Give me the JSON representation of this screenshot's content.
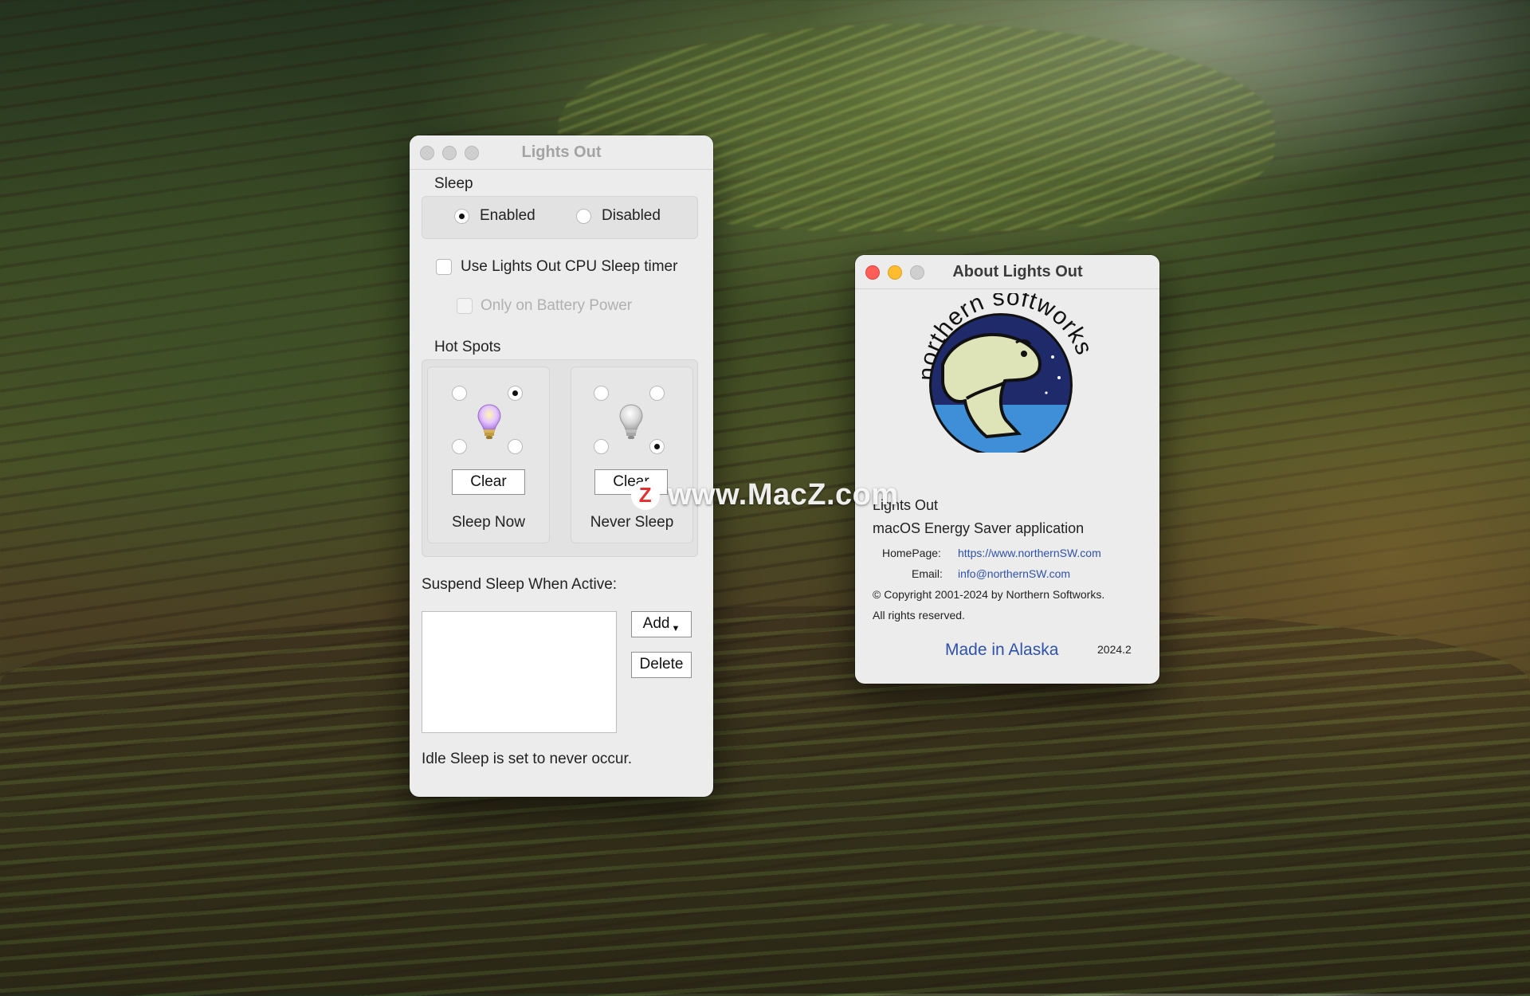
{
  "desktop": {
    "background": "forest-vineyard-wallpaper"
  },
  "main_window": {
    "title": "Lights Out",
    "sleep": {
      "section_label": "Sleep",
      "options": [
        {
          "label": "Enabled",
          "selected": true
        },
        {
          "label": "Disabled",
          "selected": false
        }
      ]
    },
    "cpu_timer": {
      "label": "Use Lights Out CPU Sleep timer",
      "checked": false
    },
    "battery_only": {
      "label": "Only on Battery Power",
      "checked": false,
      "enabled": false
    },
    "hot_spots": {
      "section_label": "Hot Spots",
      "panels": [
        {
          "clear_label": "Clear",
          "caption": "Sleep Now",
          "selected_corner": "top-right",
          "bulb": "lit-bulb-icon"
        },
        {
          "clear_label": "Clear",
          "caption": "Never Sleep",
          "selected_corner": "bottom-right",
          "bulb": "unlit-bulb-icon"
        }
      ]
    },
    "suspend": {
      "label": "Suspend Sleep When Active:",
      "add_label": "Add",
      "delete_label": "Delete",
      "items": []
    },
    "status": "Idle Sleep is set to never occur."
  },
  "about_window": {
    "title": "About Lights Out",
    "logo_text": "northern softworks",
    "app_name": "Lights Out",
    "description": "macOS Energy Saver application",
    "homepage_label": "HomePage:",
    "homepage_url": "https://www.northernSW.com",
    "email_label": "Email:",
    "email": "info@northernSW.com",
    "copyright": "© Copyright 2001-2024 by Northern Softworks.",
    "rights": "All rights reserved.",
    "made_in": "Made in Alaska",
    "version": "2024.2"
  },
  "watermark": {
    "text": "www.MacZ.com",
    "icon_letter": "Z"
  },
  "colors": {
    "window_bg": "#ececec",
    "link": "#2f52a8",
    "close": "#ff5f57",
    "minimize": "#febc2e",
    "logo_navy": "#1f2a6b",
    "logo_sea": "#3f8fd8",
    "logo_bear": "#dfe3b8"
  }
}
